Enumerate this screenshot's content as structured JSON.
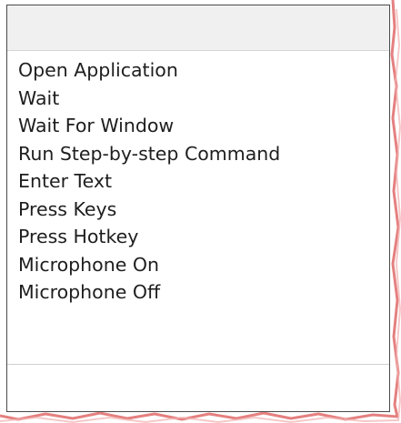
{
  "command_list": {
    "items": [
      {
        "label": "Open Application"
      },
      {
        "label": "Wait"
      },
      {
        "label": "Wait For Window"
      },
      {
        "label": "Run Step-by-step Command"
      },
      {
        "label": "Enter Text"
      },
      {
        "label": "Press Keys"
      },
      {
        "label": "Press Hotkey"
      },
      {
        "label": "Microphone On"
      },
      {
        "label": "Microphone Off"
      }
    ]
  },
  "colors": {
    "border": "#4a4a4a",
    "header_bg": "#f0f0f0",
    "text": "#1e1e1e",
    "torn_edge": "#e06a6a"
  }
}
